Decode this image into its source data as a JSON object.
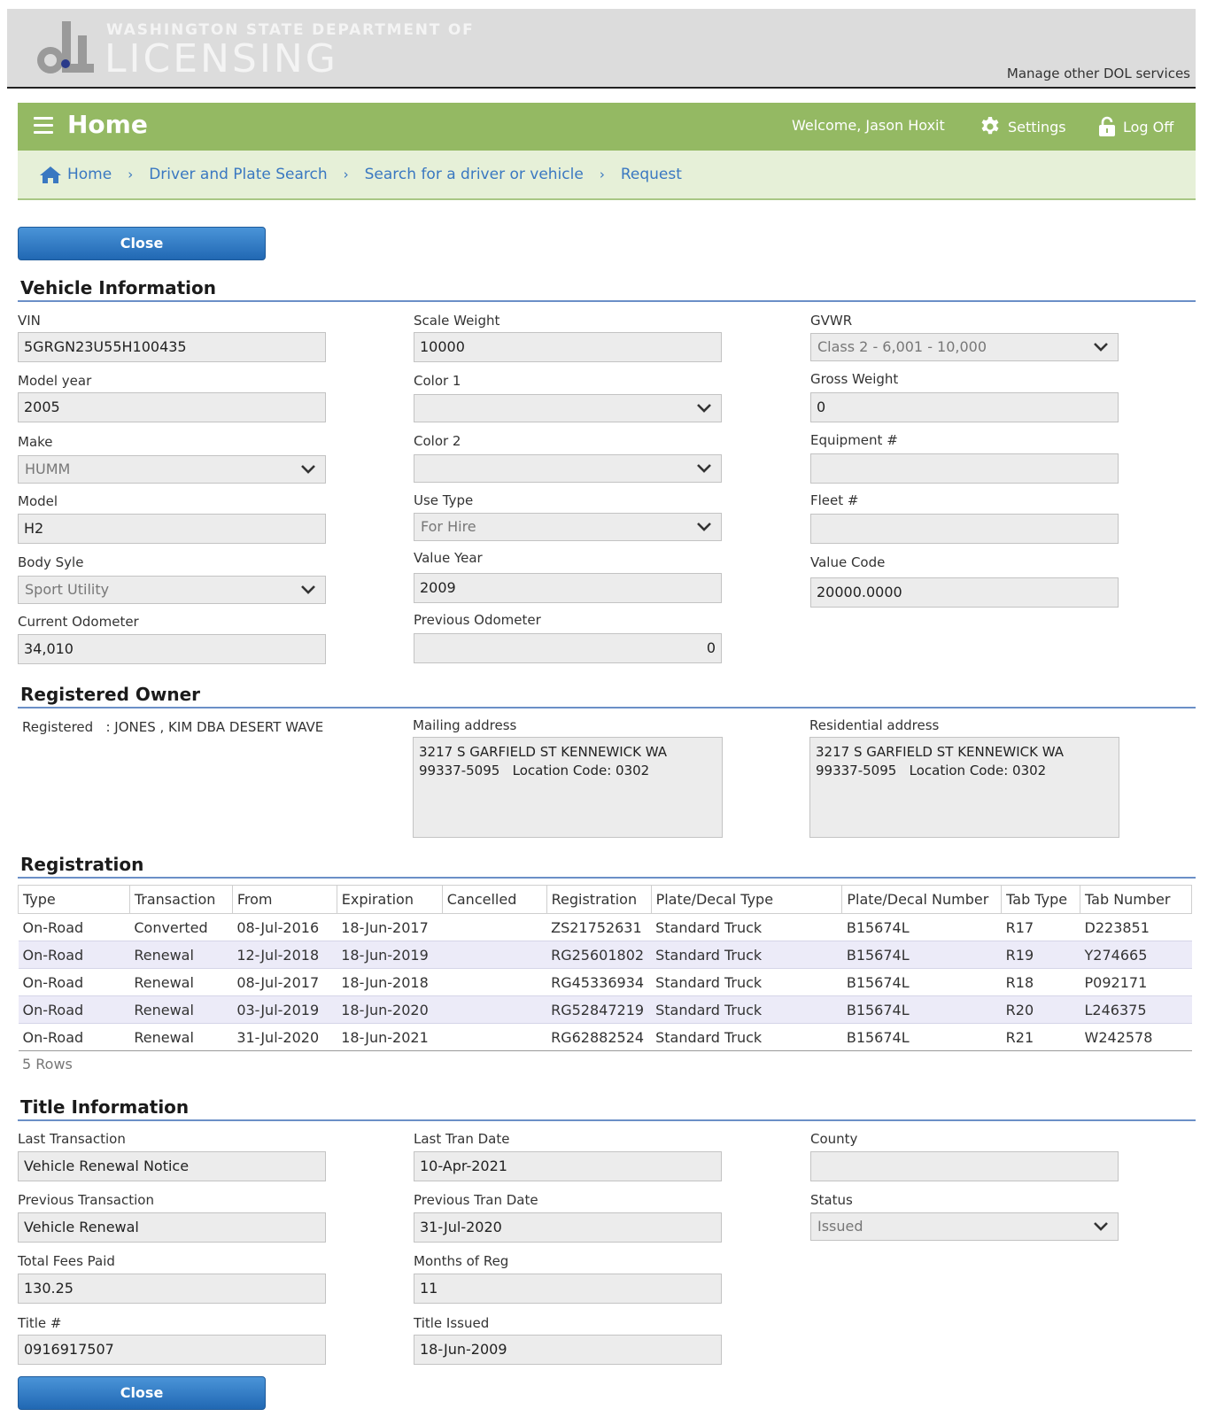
{
  "banner": {
    "agency_top": "WASHINGTON STATE DEPARTMENT OF",
    "agency_main": "LICENSING",
    "manage_link": "Manage other DOL services"
  },
  "header": {
    "title": "Home",
    "welcome": "Welcome, Jason Hoxit",
    "settings": "Settings",
    "logoff": "Log Off"
  },
  "breadcrumb": [
    "Home",
    "Driver and Plate Search",
    "Search for a driver or vehicle",
    "Request"
  ],
  "buttons": {
    "close": "Close"
  },
  "vehicle": {
    "heading": "Vehicle Information",
    "vin": {
      "label": "VIN",
      "value": "5GRGN23U55H100435"
    },
    "model_year": {
      "label": "Model year",
      "value": "2005"
    },
    "make": {
      "label": "Make",
      "value": "HUMM"
    },
    "model": {
      "label": "Model",
      "value": "H2"
    },
    "body_style": {
      "label": "Body Syle",
      "value": "Sport Utility"
    },
    "current_odometer": {
      "label": "Current Odometer",
      "value": "34,010"
    },
    "scale_weight": {
      "label": "Scale Weight",
      "value": "10000"
    },
    "color1": {
      "label": "Color 1",
      "value": ""
    },
    "color2": {
      "label": "Color 2",
      "value": ""
    },
    "use_type": {
      "label": "Use Type",
      "value": "For Hire"
    },
    "value_year": {
      "label": "Value Year",
      "value": "2009"
    },
    "previous_odometer": {
      "label": "Previous Odometer",
      "value": "0"
    },
    "gvwr": {
      "label": "GVWR",
      "value": "Class 2 - 6,001 - 10,000"
    },
    "gross_weight": {
      "label": "Gross Weight",
      "value": "0"
    },
    "equipment": {
      "label": "Equipment #",
      "value": ""
    },
    "fleet": {
      "label": "Fleet #",
      "value": ""
    },
    "value_code": {
      "label": "Value Code",
      "value": "20000.0000"
    }
  },
  "owner": {
    "heading": "Registered Owner",
    "registered": "Registered   : JONES , KIM DBA DESERT WAVE",
    "mailing_label": "Mailing address",
    "mailing_value": "3217 S GARFIELD ST KENNEWICK WA\n99337-5095   Location Code: 0302",
    "residential_label": "Residential address",
    "residential_value": "3217 S GARFIELD ST KENNEWICK WA\n99337-5095   Location Code: 0302"
  },
  "registration": {
    "heading": "Registration",
    "columns": [
      "Type",
      "Transaction",
      "From",
      "Expiration",
      "Cancelled",
      "Registration",
      "Plate/Decal Type",
      "Plate/Decal Number",
      "Tab Type",
      "Tab Number"
    ],
    "rows": [
      [
        "On-Road",
        "Converted",
        "08-Jul-2016",
        "18-Jun-2017",
        "",
        "ZS21752631",
        "Standard Truck",
        "B15674L",
        "R17",
        "D223851"
      ],
      [
        "On-Road",
        "Renewal",
        "12-Jul-2018",
        "18-Jun-2019",
        "",
        "RG25601802",
        "Standard Truck",
        "B15674L",
        "R19",
        "Y274665"
      ],
      [
        "On-Road",
        "Renewal",
        "08-Jul-2017",
        "18-Jun-2018",
        "",
        "RG45336934",
        "Standard Truck",
        "B15674L",
        "R18",
        "P092171"
      ],
      [
        "On-Road",
        "Renewal",
        "03-Jul-2019",
        "18-Jun-2020",
        "",
        "RG52847219",
        "Standard Truck",
        "B15674L",
        "R20",
        "L246375"
      ],
      [
        "On-Road",
        "Renewal",
        "31-Jul-2020",
        "18-Jun-2021",
        "",
        "RG62882524",
        "Standard Truck",
        "B15674L",
        "R21",
        "W242578"
      ]
    ],
    "row_count": "5 Rows"
  },
  "title_info": {
    "heading": "Title Information",
    "last_transaction": {
      "label": "Last Transaction",
      "value": "Vehicle Renewal Notice"
    },
    "previous_transaction": {
      "label": "Previous Transaction",
      "value": "Vehicle Renewal"
    },
    "total_fees": {
      "label": "Total Fees Paid",
      "value": "130.25"
    },
    "title_number": {
      "label": "Title #",
      "value": "0916917507"
    },
    "last_tran_date": {
      "label": "Last Tran Date",
      "value": "10-Apr-2021"
    },
    "previous_tran_date": {
      "label": "Previous Tran Date",
      "value": "31-Jul-2020"
    },
    "months_of_reg": {
      "label": "Months of Reg",
      "value": "11"
    },
    "title_issued": {
      "label": "Title Issued",
      "value": "18-Jun-2009"
    },
    "county": {
      "label": "County",
      "value": ""
    },
    "status": {
      "label": "Status",
      "value": "Issued"
    }
  },
  "colors": {
    "green_bar": "#94b963",
    "breadcrumb_bg": "#e6f0d8",
    "button_blue": "#2a74be",
    "link_blue": "#3a78c1"
  },
  "icons": {
    "menu": "hamburger-icon",
    "settings": "gear-icon",
    "logoff": "lock-icon",
    "home": "house-icon",
    "select": "chevron-down-icon"
  }
}
